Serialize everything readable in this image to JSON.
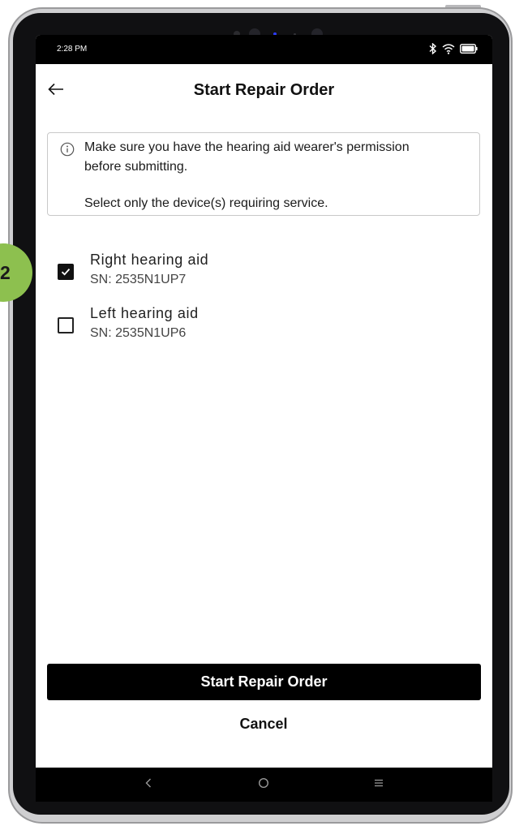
{
  "status_bar": {
    "time": "2:28 PM",
    "icons": [
      "bluetooth-icon",
      "wifi-icon",
      "battery-icon"
    ]
  },
  "header": {
    "back_icon": "arrow-left-icon",
    "title": "Start Repair Order"
  },
  "info": {
    "icon": "info-circle-icon",
    "line1": "Make sure you have the hearing aid wearer's permission",
    "line2": "before submitting.",
    "line3": "Select only the device(s) requiring service."
  },
  "devices": [
    {
      "name": "Right hearing aid",
      "serial": "SN: 2535N1UP7",
      "checked": true
    },
    {
      "name": "Left hearing aid",
      "serial": "SN: 2535N1UP6",
      "checked": false
    }
  ],
  "actions": {
    "primary": "Start Repair Order",
    "cancel": "Cancel"
  },
  "nav_bar": {
    "icons": [
      "nav-back-icon",
      "nav-home-icon",
      "nav-recents-icon"
    ]
  },
  "annotation": {
    "step_number": "2",
    "color": "#8dc04f"
  },
  "colors": {
    "primary_button": "#000000",
    "text": "#111111",
    "border": "#c9c9c9"
  }
}
